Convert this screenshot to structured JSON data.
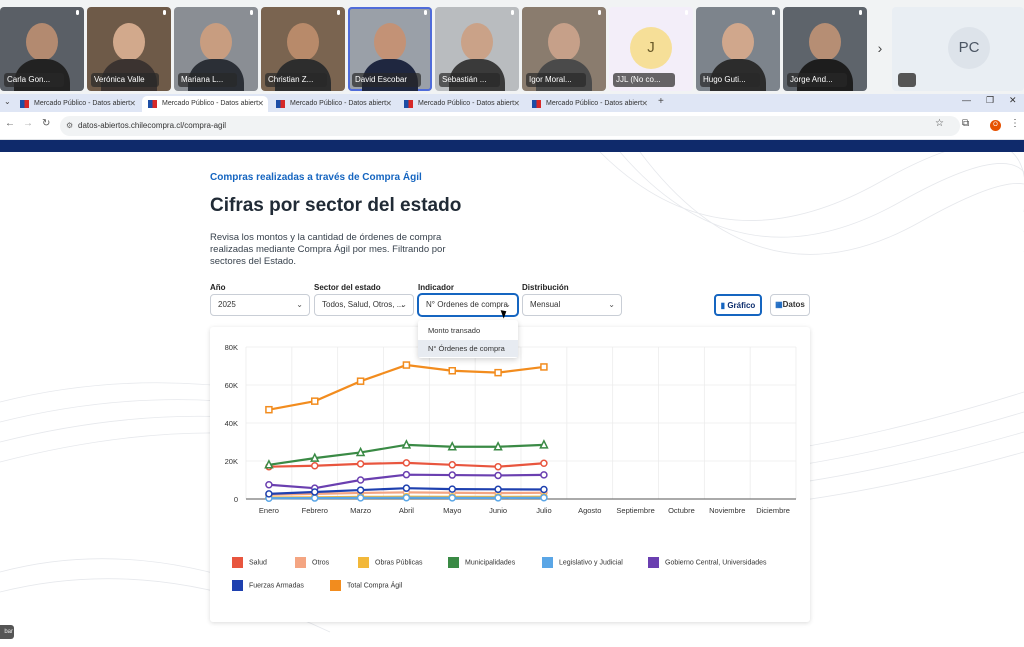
{
  "meeting": {
    "participants": [
      {
        "name": "Carla Gon..."
      },
      {
        "name": "Verónica Valle"
      },
      {
        "name": "Mariana L..."
      },
      {
        "name": "Christian Z..."
      },
      {
        "name": "David Escobar"
      },
      {
        "name": "Sebastián ..."
      },
      {
        "name": "Igor Moral..."
      },
      {
        "name": "JJL (No co...",
        "initial": "J"
      },
      {
        "name": "Hugo Guti..."
      },
      {
        "name": "Jorge And..."
      }
    ],
    "self_initials": "PC",
    "next_glyph": "›"
  },
  "browser": {
    "tabs": [
      {
        "label": "Mercado Público - Datos abiert"
      },
      {
        "label": "Mercado Público - Datos abiert"
      },
      {
        "label": "Mercado Público - Datos abiert"
      },
      {
        "label": "Mercado Público - Datos abiert"
      },
      {
        "label": "Mercado Público - Datos abiert"
      }
    ],
    "url": "datos-abiertos.chilecompra.cl/compra-agil",
    "profile_initial": "O"
  },
  "page": {
    "eyebrow": "Compras realizadas a través de Compra Ágil",
    "title": "Cifras por sector del estado",
    "description": "Revisa los montos y la cantidad de órdenes de compra realizadas mediante Compra Ágil por mes. Filtrando por sectores del Estado.",
    "filters": {
      "year": {
        "label": "Año",
        "value": "2025"
      },
      "sector": {
        "label": "Sector del estado",
        "value": "Todos, Salud, Otros, ..."
      },
      "indicator": {
        "label": "Indicador",
        "value": "N° Ordenes de compra"
      },
      "distribution": {
        "label": "Distribución",
        "value": "Mensual"
      }
    },
    "indicator_options": [
      "Monto transado",
      "N° Órdenes de compra"
    ],
    "view_buttons": {
      "chart": "Gráfico",
      "data": "Datos"
    },
    "side_tab": "bar"
  },
  "chart_data": {
    "type": "line",
    "categories": [
      "Enero",
      "Febrero",
      "Marzo",
      "Abril",
      "Mayo",
      "Junio",
      "Julio",
      "Agosto",
      "Septiembre",
      "Octubre",
      "Noviembre",
      "Diciembre"
    ],
    "y_ticks": [
      "0",
      "20K",
      "40K",
      "60K",
      "80K"
    ],
    "ylim": [
      0,
      80000
    ],
    "grid": true,
    "legend_position": "bottom",
    "series": [
      {
        "name": "Salud",
        "color": "#e8553e",
        "marker": "circle",
        "values": [
          17000,
          17500,
          18500,
          19000,
          18000,
          17000,
          18800
        ]
      },
      {
        "name": "Otros",
        "color": "#f4a582",
        "marker": "circle",
        "values": [
          2200,
          2700,
          3200,
          3500,
          3300,
          3100,
          3300
        ]
      },
      {
        "name": "Obras Públicas",
        "color": "#f2b83a",
        "marker": "circle",
        "values": [
          800,
          900,
          1100,
          1200,
          1150,
          1100,
          1200
        ]
      },
      {
        "name": "Municipalidades",
        "color": "#3a8a45",
        "marker": "triangle",
        "values": [
          18000,
          21500,
          24500,
          28500,
          27500,
          27500,
          28500
        ]
      },
      {
        "name": "Legislativo y Judicial",
        "color": "#5aa6e6",
        "marker": "circle",
        "values": [
          400,
          500,
          600,
          650,
          600,
          600,
          650
        ]
      },
      {
        "name": "Gobierno Central, Universidades",
        "color": "#6a3fb0",
        "marker": "circle",
        "values": [
          7500,
          5700,
          10000,
          12800,
          12600,
          12400,
          12700
        ]
      },
      {
        "name": "Fuerzas Armadas",
        "color": "#1e40af",
        "marker": "circle",
        "values": [
          2700,
          3700,
          4700,
          5700,
          5200,
          5100,
          5000
        ]
      },
      {
        "name": "Total Compra Ágil",
        "color": "#f28c1e",
        "marker": "square",
        "values": [
          47000,
          51500,
          62000,
          70500,
          67500,
          66500,
          69500
        ]
      }
    ]
  }
}
